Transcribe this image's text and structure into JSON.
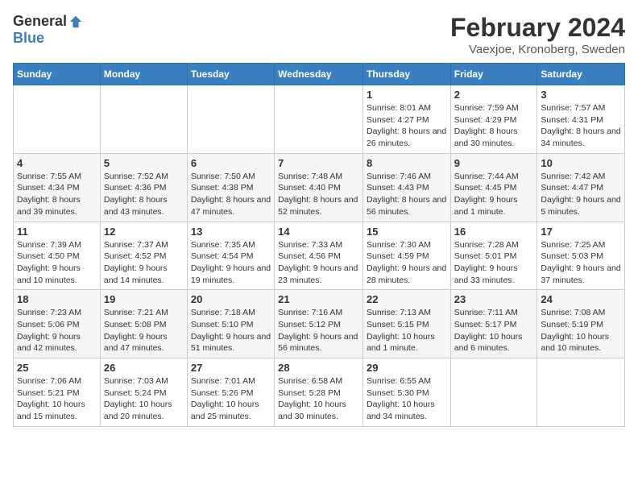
{
  "header": {
    "logo_general": "General",
    "logo_blue": "Blue",
    "month": "February 2024",
    "location": "Vaexjoe, Kronoberg, Sweden"
  },
  "days_of_week": [
    "Sunday",
    "Monday",
    "Tuesday",
    "Wednesday",
    "Thursday",
    "Friday",
    "Saturday"
  ],
  "weeks": [
    [
      {
        "day": "",
        "empty": true
      },
      {
        "day": "",
        "empty": true
      },
      {
        "day": "",
        "empty": true
      },
      {
        "day": "",
        "empty": true
      },
      {
        "day": "1",
        "sunrise": "8:01 AM",
        "sunset": "4:27 PM",
        "daylight": "8 hours and 26 minutes."
      },
      {
        "day": "2",
        "sunrise": "7:59 AM",
        "sunset": "4:29 PM",
        "daylight": "8 hours and 30 minutes."
      },
      {
        "day": "3",
        "sunrise": "7:57 AM",
        "sunset": "4:31 PM",
        "daylight": "8 hours and 34 minutes."
      }
    ],
    [
      {
        "day": "4",
        "sunrise": "7:55 AM",
        "sunset": "4:34 PM",
        "daylight": "8 hours and 39 minutes."
      },
      {
        "day": "5",
        "sunrise": "7:52 AM",
        "sunset": "4:36 PM",
        "daylight": "8 hours and 43 minutes."
      },
      {
        "day": "6",
        "sunrise": "7:50 AM",
        "sunset": "4:38 PM",
        "daylight": "8 hours and 47 minutes."
      },
      {
        "day": "7",
        "sunrise": "7:48 AM",
        "sunset": "4:40 PM",
        "daylight": "8 hours and 52 minutes."
      },
      {
        "day": "8",
        "sunrise": "7:46 AM",
        "sunset": "4:43 PM",
        "daylight": "8 hours and 56 minutes."
      },
      {
        "day": "9",
        "sunrise": "7:44 AM",
        "sunset": "4:45 PM",
        "daylight": "9 hours and 1 minute."
      },
      {
        "day": "10",
        "sunrise": "7:42 AM",
        "sunset": "4:47 PM",
        "daylight": "9 hours and 5 minutes."
      }
    ],
    [
      {
        "day": "11",
        "sunrise": "7:39 AM",
        "sunset": "4:50 PM",
        "daylight": "9 hours and 10 minutes."
      },
      {
        "day": "12",
        "sunrise": "7:37 AM",
        "sunset": "4:52 PM",
        "daylight": "9 hours and 14 minutes."
      },
      {
        "day": "13",
        "sunrise": "7:35 AM",
        "sunset": "4:54 PM",
        "daylight": "9 hours and 19 minutes."
      },
      {
        "day": "14",
        "sunrise": "7:33 AM",
        "sunset": "4:56 PM",
        "daylight": "9 hours and 23 minutes."
      },
      {
        "day": "15",
        "sunrise": "7:30 AM",
        "sunset": "4:59 PM",
        "daylight": "9 hours and 28 minutes."
      },
      {
        "day": "16",
        "sunrise": "7:28 AM",
        "sunset": "5:01 PM",
        "daylight": "9 hours and 33 minutes."
      },
      {
        "day": "17",
        "sunrise": "7:25 AM",
        "sunset": "5:03 PM",
        "daylight": "9 hours and 37 minutes."
      }
    ],
    [
      {
        "day": "18",
        "sunrise": "7:23 AM",
        "sunset": "5:06 PM",
        "daylight": "9 hours and 42 minutes."
      },
      {
        "day": "19",
        "sunrise": "7:21 AM",
        "sunset": "5:08 PM",
        "daylight": "9 hours and 47 minutes."
      },
      {
        "day": "20",
        "sunrise": "7:18 AM",
        "sunset": "5:10 PM",
        "daylight": "9 hours and 51 minutes."
      },
      {
        "day": "21",
        "sunrise": "7:16 AM",
        "sunset": "5:12 PM",
        "daylight": "9 hours and 56 minutes."
      },
      {
        "day": "22",
        "sunrise": "7:13 AM",
        "sunset": "5:15 PM",
        "daylight": "10 hours and 1 minute."
      },
      {
        "day": "23",
        "sunrise": "7:11 AM",
        "sunset": "5:17 PM",
        "daylight": "10 hours and 6 minutes."
      },
      {
        "day": "24",
        "sunrise": "7:08 AM",
        "sunset": "5:19 PM",
        "daylight": "10 hours and 10 minutes."
      }
    ],
    [
      {
        "day": "25",
        "sunrise": "7:06 AM",
        "sunset": "5:21 PM",
        "daylight": "10 hours and 15 minutes."
      },
      {
        "day": "26",
        "sunrise": "7:03 AM",
        "sunset": "5:24 PM",
        "daylight": "10 hours and 20 minutes."
      },
      {
        "day": "27",
        "sunrise": "7:01 AM",
        "sunset": "5:26 PM",
        "daylight": "10 hours and 25 minutes."
      },
      {
        "day": "28",
        "sunrise": "6:58 AM",
        "sunset": "5:28 PM",
        "daylight": "10 hours and 30 minutes."
      },
      {
        "day": "29",
        "sunrise": "6:55 AM",
        "sunset": "5:30 PM",
        "daylight": "10 hours and 34 minutes."
      },
      {
        "day": "",
        "empty": true
      },
      {
        "day": "",
        "empty": true
      }
    ]
  ]
}
